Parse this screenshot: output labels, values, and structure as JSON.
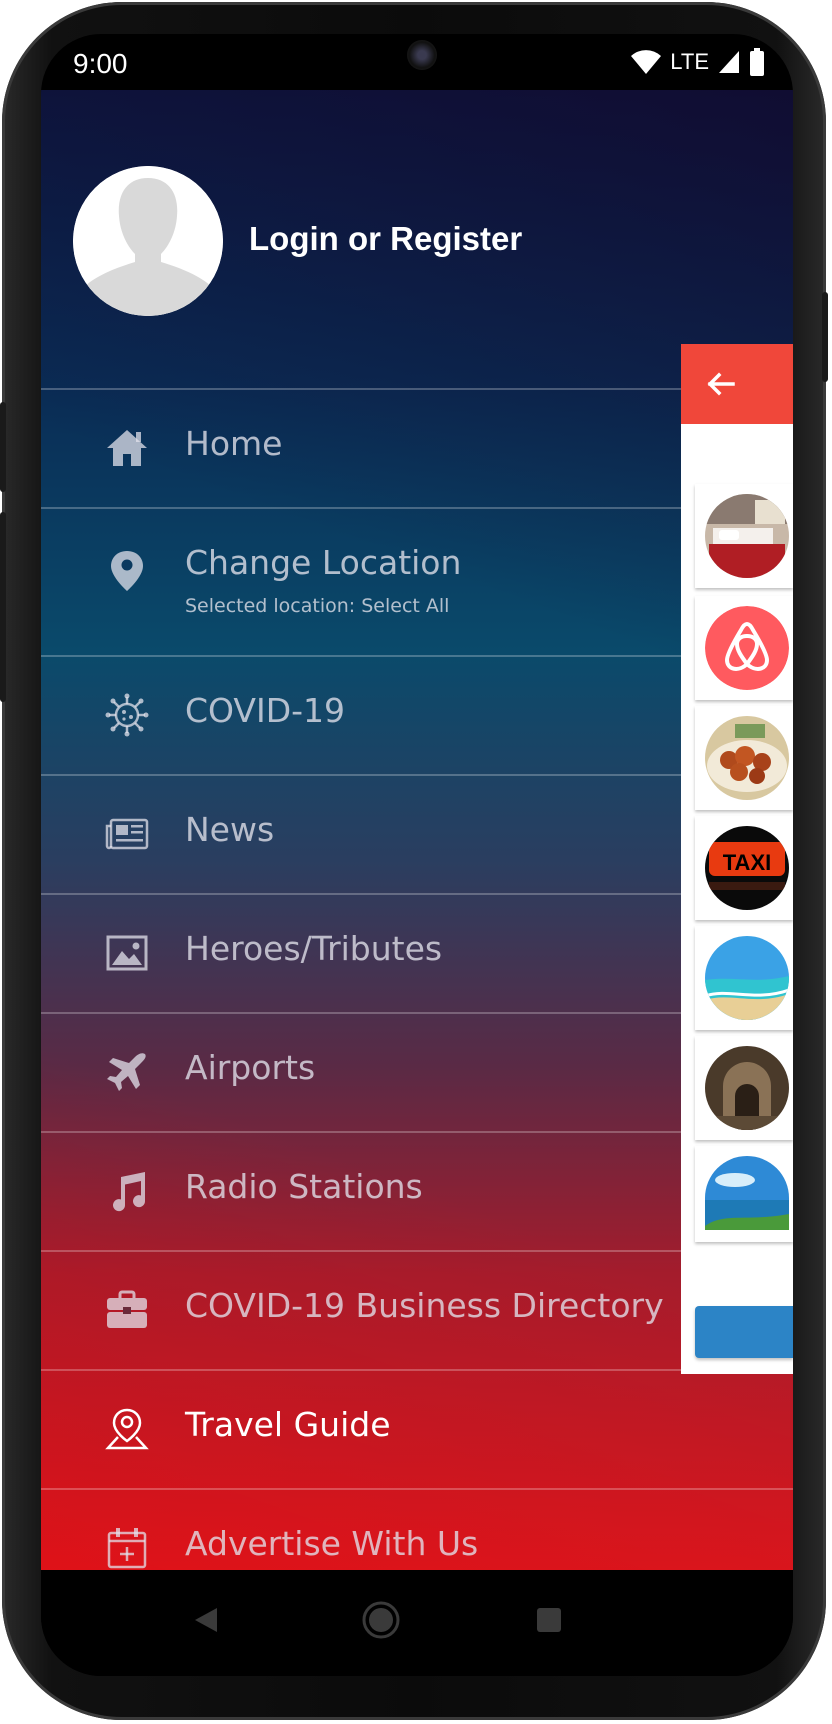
{
  "status_bar": {
    "time": "9:00",
    "network": "LTE",
    "icons": [
      "wifi-icon",
      "signal-icon",
      "battery-icon"
    ]
  },
  "drawer": {
    "login_text": "Login or Register",
    "items": [
      {
        "label": "Home",
        "icon": "home-icon"
      },
      {
        "label": "Change Location",
        "sub": "Selected location: Select All",
        "icon": "location-pin-icon"
      },
      {
        "label": "COVID-19",
        "icon": "virus-icon"
      },
      {
        "label": "News",
        "icon": "newspaper-icon"
      },
      {
        "label": "Heroes/Tributes",
        "icon": "image-icon"
      },
      {
        "label": "Airports",
        "icon": "airplane-icon"
      },
      {
        "label": "Radio Stations",
        "icon": "music-note-icon"
      },
      {
        "label": "COVID-19 Business Directory",
        "icon": "briefcase-icon"
      },
      {
        "label": "Travel Guide",
        "icon": "map-pin-icon",
        "active": true
      },
      {
        "label": "Advertise With Us",
        "icon": "calendar-add-icon"
      }
    ]
  },
  "side_panel": {
    "back_icon": "arrow-left-icon",
    "taxi_sign_text": "TAXI",
    "thumbnails": [
      "hotel-room",
      "airbnb-logo",
      "food-dish",
      "taxi-sign",
      "beach",
      "old-archway",
      "coastline"
    ]
  },
  "colors": {
    "accent_red": "#f0473a",
    "button_blue": "#2c84c6",
    "airbnb_pink": "#ff5a5f"
  },
  "nav_bar": {
    "buttons": [
      "back-icon",
      "home-circle-icon",
      "recents-square-icon"
    ]
  }
}
